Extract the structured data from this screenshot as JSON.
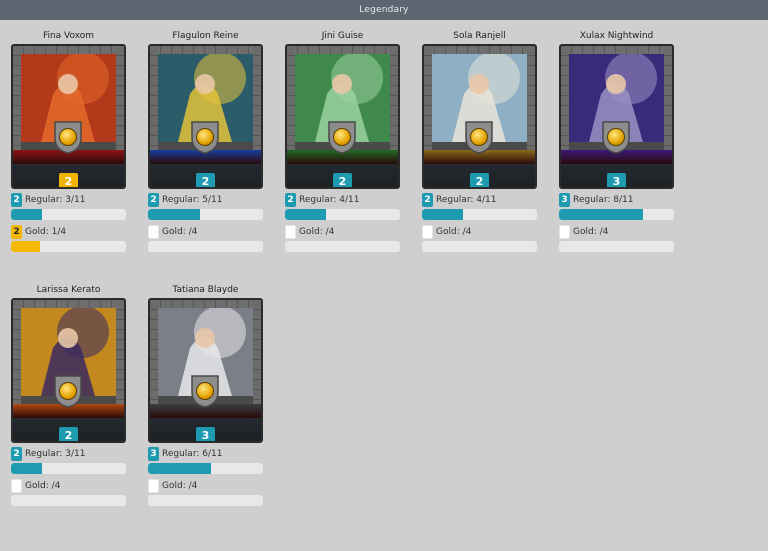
{
  "window": {
    "title": "Legendary"
  },
  "colors": {
    "regular_bar": "#1e9bb0",
    "gold_bar": "#f5b800",
    "track": "#e8e8e8"
  },
  "cards": [
    {
      "name": "Fina Voxom",
      "level": "2",
      "level_style": "gold",
      "ribbon": "#8b1414",
      "art_bg": "#b2391a",
      "art_fg": "#e36a2a",
      "regular": {
        "badge": "2",
        "label": "Regular: 3/11",
        "progress": 0.27
      },
      "gold": {
        "badge": "2",
        "label": "Gold: 1/4",
        "progress": 0.25
      }
    },
    {
      "name": "Flagulon Reine",
      "level": "2",
      "level_style": "teal",
      "ribbon": "#173f9c",
      "art_bg": "#2a5c6a",
      "art_fg": "#e3c23a",
      "regular": {
        "badge": "2",
        "label": "Regular: 5/11",
        "progress": 0.45
      },
      "gold": {
        "badge": "",
        "label": "Gold: /4",
        "progress": 0
      }
    },
    {
      "name": "Jini Guise",
      "level": "2",
      "level_style": "teal",
      "ribbon": "#1f6a25",
      "art_bg": "#3f8a4a",
      "art_fg": "#9ad1a0",
      "regular": {
        "badge": "2",
        "label": "Regular: 4/11",
        "progress": 0.36
      },
      "gold": {
        "badge": "",
        "label": "Gold: /4",
        "progress": 0
      }
    },
    {
      "name": "Sola Ranjell",
      "level": "2",
      "level_style": "teal",
      "ribbon": "#8a6a1a",
      "art_bg": "#8fb0c4",
      "art_fg": "#e8e4d8",
      "regular": {
        "badge": "2",
        "label": "Regular: 4/11",
        "progress": 0.36
      },
      "gold": {
        "badge": "",
        "label": "Gold: /4",
        "progress": 0
      }
    },
    {
      "name": "Xulax Nightwind",
      "level": "3",
      "level_style": "teal",
      "ribbon": "#3d1a7a",
      "art_bg": "#3a2a7a",
      "art_fg": "#9a92c4",
      "regular": {
        "badge": "3",
        "label": "Regular: 8/11",
        "progress": 0.73
      },
      "gold": {
        "badge": "",
        "label": "Gold: /4",
        "progress": 0
      }
    },
    {
      "name": "Larissa Kerato",
      "level": "2",
      "level_style": "teal",
      "ribbon": "#b04a12",
      "art_bg": "#c4891e",
      "art_fg": "#3a2a60",
      "regular": {
        "badge": "2",
        "label": "Regular: 3/11",
        "progress": 0.27
      },
      "gold": {
        "badge": "",
        "label": "Gold: /4",
        "progress": 0
      }
    },
    {
      "name": "Tatiana Blayde",
      "level": "3",
      "level_style": "teal",
      "ribbon": "#3a3f45",
      "art_bg": "#7a7f88",
      "art_fg": "#e7e7ea",
      "regular": {
        "badge": "3",
        "label": "Regular: 6/11",
        "progress": 0.55
      },
      "gold": {
        "badge": "",
        "label": "Gold: /4",
        "progress": 0
      }
    }
  ]
}
